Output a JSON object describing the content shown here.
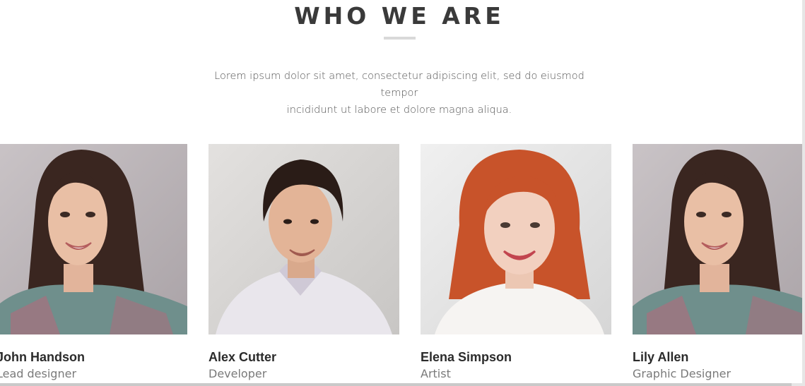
{
  "section": {
    "title": "WHO WE ARE",
    "intro_line1": "Lorem ipsum dolor sit amet, consectetur adipiscing elit, sed do eiusmod tempor",
    "intro_line2": "incididunt ut labore et dolore magna aliqua."
  },
  "team": [
    {
      "name": "John Handson",
      "role": "Lead designer",
      "photo": "woman-brown-hair-plaid-shirt"
    },
    {
      "name": "Alex Cutter",
      "role": "Developer",
      "photo": "man-dark-hair-white-shirt"
    },
    {
      "name": "Elena Simpson",
      "role": "Artist",
      "photo": "woman-red-hair-white-shirt"
    },
    {
      "name": "Lily Allen",
      "role": "Graphic Designer",
      "photo": "woman-brown-hair-plaid-shirt"
    }
  ],
  "colors": {
    "title": "#3a3a3a",
    "underline": "#d9d9d9",
    "intro_text": "#555555",
    "name_text": "#2b2b2b",
    "role_text": "#7a7a7a"
  }
}
